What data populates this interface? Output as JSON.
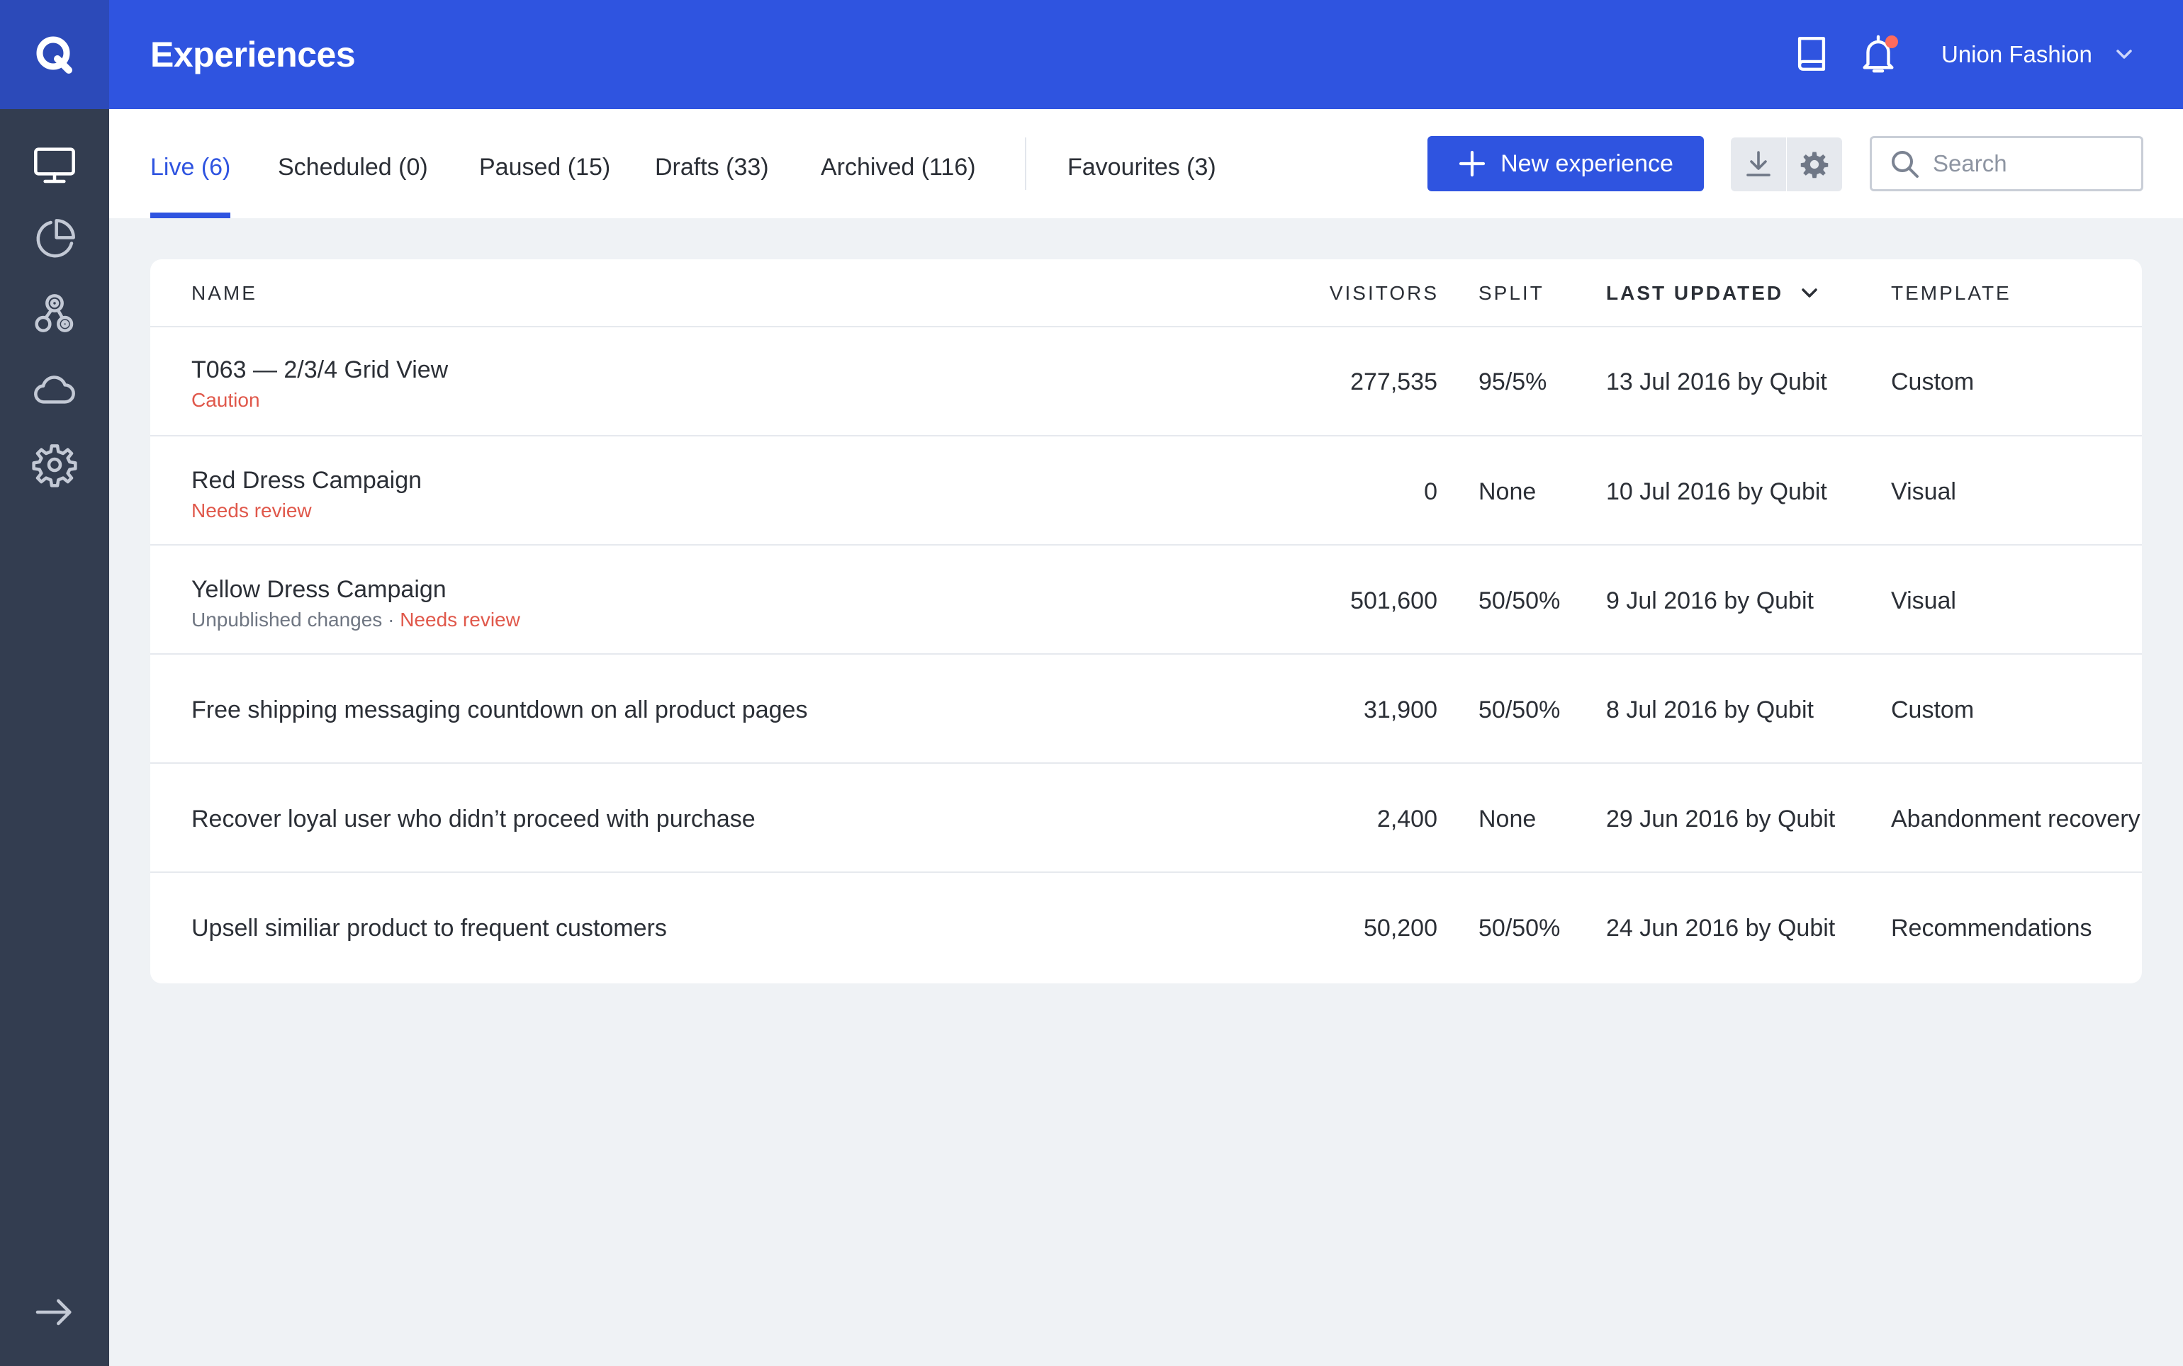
{
  "app": {
    "logo_letter": "Q",
    "page_title": "Experiences"
  },
  "rail": {
    "items": [
      {
        "icon": "monitor-icon",
        "active": true
      },
      {
        "icon": "pie-chart-icon",
        "active": false
      },
      {
        "icon": "segments-icon",
        "active": false
      },
      {
        "icon": "cloud-icon",
        "active": false
      },
      {
        "icon": "gear-icon",
        "active": false
      }
    ],
    "footer_icon": "arrow-right-icon"
  },
  "header": {
    "docs_icon": "book-icon",
    "notifications_icon": "bell-icon",
    "account_name": "Union Fashion"
  },
  "tabs": [
    {
      "label": "Live (6)",
      "active": true
    },
    {
      "label": "Scheduled (0)",
      "active": false
    },
    {
      "label": "Paused (15)",
      "active": false
    },
    {
      "label": "Drafts (33)",
      "active": false
    },
    {
      "label": "Archived (116)",
      "active": false
    },
    {
      "label": "Favourites (3)",
      "active": false
    }
  ],
  "toolbar": {
    "new_label": "New experience",
    "search_placeholder": "Search"
  },
  "table": {
    "columns": {
      "name": "NAME",
      "visitors": "VISITORS",
      "split": "SPLIT",
      "last_updated": "LAST UPDATED",
      "template": "TEMPLATE"
    },
    "sorted_by": "last_updated",
    "rows": [
      {
        "name": "T063 — 2/3/4 Grid View",
        "status_muted": "",
        "status_sep": "",
        "status_warn": "Caution",
        "visitors": "277,535",
        "split": "95/5%",
        "updated": "13 Jul 2016 by Qubit",
        "template": "Custom"
      },
      {
        "name": "Red Dress Campaign",
        "status_muted": "",
        "status_sep": "",
        "status_warn": "Needs review",
        "visitors": "0",
        "split": "None",
        "updated": "10 Jul 2016 by Qubit",
        "template": "Visual"
      },
      {
        "name": "Yellow Dress Campaign",
        "status_muted": "Unpublished changes",
        "status_sep": " · ",
        "status_warn": "Needs review",
        "visitors": "501,600",
        "split": "50/50%",
        "updated": "9 Jul 2016 by Qubit",
        "template": "Visual"
      },
      {
        "name": "Free shipping messaging countdown on all product pages",
        "status_muted": "",
        "status_sep": "",
        "status_warn": "",
        "visitors": "31,900",
        "split": "50/50%",
        "updated": "8 Jul 2016 by Qubit",
        "template": "Custom"
      },
      {
        "name": "Recover loyal user who didn’t proceed with purchase",
        "status_muted": "",
        "status_sep": "",
        "status_warn": "",
        "visitors": "2,400",
        "split": "None",
        "updated": "29 Jun 2016 by Qubit",
        "template": "Abandonment recovery"
      },
      {
        "name": "Upsell similiar product to frequent customers",
        "status_muted": "",
        "status_sep": "",
        "status_warn": "",
        "visitors": "50,200",
        "split": "50/50%",
        "updated": "24 Jun 2016 by Qubit",
        "template": "Recommendations"
      }
    ]
  },
  "colors": {
    "brand_blue": "#2f54e0",
    "rail_bg": "#333d50",
    "logo_bg": "#2c4ab9",
    "warning_red": "#e0584b",
    "notification_dot": "#ff6b5d",
    "page_bg": "#eff2f5"
  }
}
